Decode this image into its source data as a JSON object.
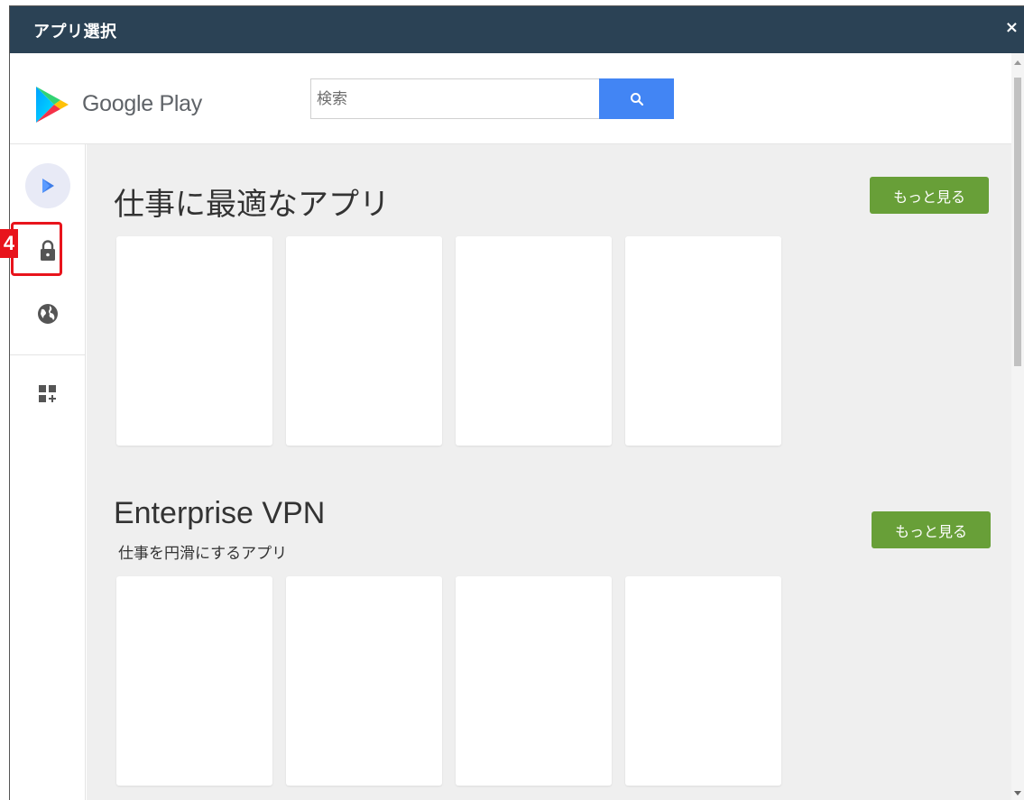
{
  "window": {
    "title": "アプリ選択",
    "close_label": "×"
  },
  "header": {
    "brand": "Google Play",
    "search_placeholder": "検索"
  },
  "sidebar": {
    "items": [
      {
        "name": "play-icon",
        "active": true
      },
      {
        "name": "lock-icon",
        "active": false
      },
      {
        "name": "globe-icon",
        "active": false
      },
      {
        "name": "add-apps-icon",
        "active": false
      }
    ]
  },
  "annotation": {
    "step_number": "4",
    "color": "#e8141c"
  },
  "sections": [
    {
      "title": "仕事に最適なアプリ",
      "subtitle": "",
      "more_label": "もっと見る"
    },
    {
      "title": "Enterprise VPN",
      "subtitle": "仕事を円滑にするアプリ",
      "more_label": "もっと見る"
    }
  ],
  "colors": {
    "titlebar": "#2b4255",
    "search_button": "#4285f4",
    "more_button": "#689f38",
    "content_bg": "#efefef"
  }
}
